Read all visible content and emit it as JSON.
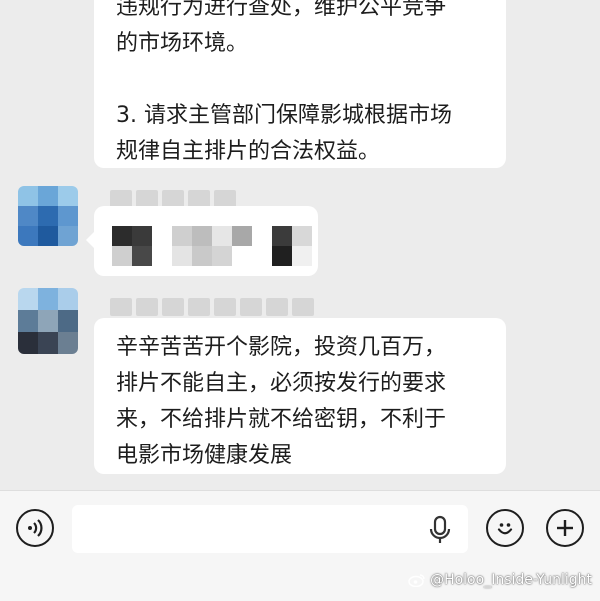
{
  "colors": {
    "background": "#ececec",
    "bubble": "#ffffff",
    "text": "#1d1d1d",
    "input_bar": "#f6f6f6"
  },
  "messages": [
    {
      "lines": [
        "违规行为进行查处，维护公平竞争",
        "的市场环境。",
        "",
        "3. 请求主管部门保障影城根据市场",
        "规律自主排片的合法权益。"
      ]
    },
    {
      "lines": [
        "辛辛苦苦开个影院，投资几百万，",
        "排片不能自主，必须按发行的要求",
        "来，不给排片就不给密钥，不利于",
        "电影市场健康发展"
      ]
    }
  ],
  "input_bar": {
    "voice_icon": "voice-wave-icon",
    "mic_icon": "microphone-icon",
    "emoji_icon": "smiley-icon",
    "add_icon": "plus-icon"
  },
  "watermark": {
    "text": "@Holoo_Inside-Yunlight",
    "icon": "weibo-logo-icon"
  }
}
